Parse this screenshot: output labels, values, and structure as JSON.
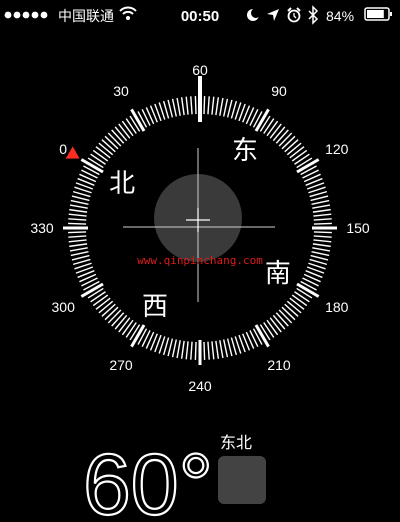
{
  "status_bar": {
    "carrier": "中国联通",
    "signal_dots": 5,
    "time": "00:50",
    "battery_percent": "84%",
    "battery_level": 0.84,
    "icons": [
      "signal-dots-icon",
      "wifi-icon",
      "moon-icon",
      "location-arrow-icon",
      "alarm-icon",
      "bluetooth-icon",
      "battery-icon"
    ]
  },
  "compass": {
    "heading": 60,
    "degree_labels": [
      "0",
      "30",
      "60",
      "90",
      "120",
      "150",
      "180",
      "210",
      "240",
      "270",
      "300",
      "330"
    ],
    "cardinals": {
      "north": "北",
      "east": "东",
      "south": "南",
      "west": "西"
    },
    "watermark": "www.qinpinchang.com",
    "colors": {
      "background": "#000000",
      "foreground": "#ffffff",
      "indicator": "#ff2d20",
      "watermark": "#e01b1b",
      "center_disc": "#3a3a3a"
    }
  },
  "reading": {
    "degrees": "60°",
    "direction": "东北"
  }
}
